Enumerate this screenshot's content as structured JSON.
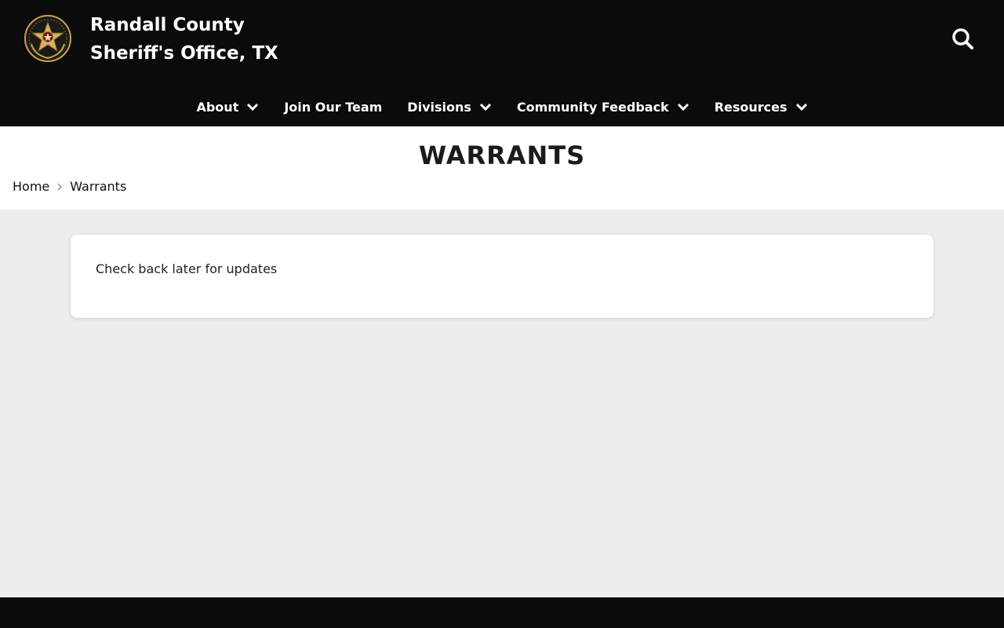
{
  "header": {
    "site_title_line1": "Randall County",
    "site_title_line2": "Sheriff's Office, TX",
    "logo": "sheriff-star-badge-logo",
    "search_icon": "search-icon"
  },
  "nav": {
    "items": [
      {
        "label": "About",
        "has_dropdown": true
      },
      {
        "label": "Join Our Team",
        "has_dropdown": false
      },
      {
        "label": "Divisions",
        "has_dropdown": true
      },
      {
        "label": "Community Feedback",
        "has_dropdown": true
      },
      {
        "label": "Resources",
        "has_dropdown": true
      }
    ]
  },
  "page": {
    "title": "WARRANTS",
    "breadcrumb": {
      "home": "Home",
      "current": "Warrants"
    }
  },
  "content": {
    "message": "Check back later for updates"
  },
  "colors": {
    "header_bg": "#0b0b0b",
    "page_bg": "#ededed",
    "accent_gold": "#c9a24a"
  }
}
